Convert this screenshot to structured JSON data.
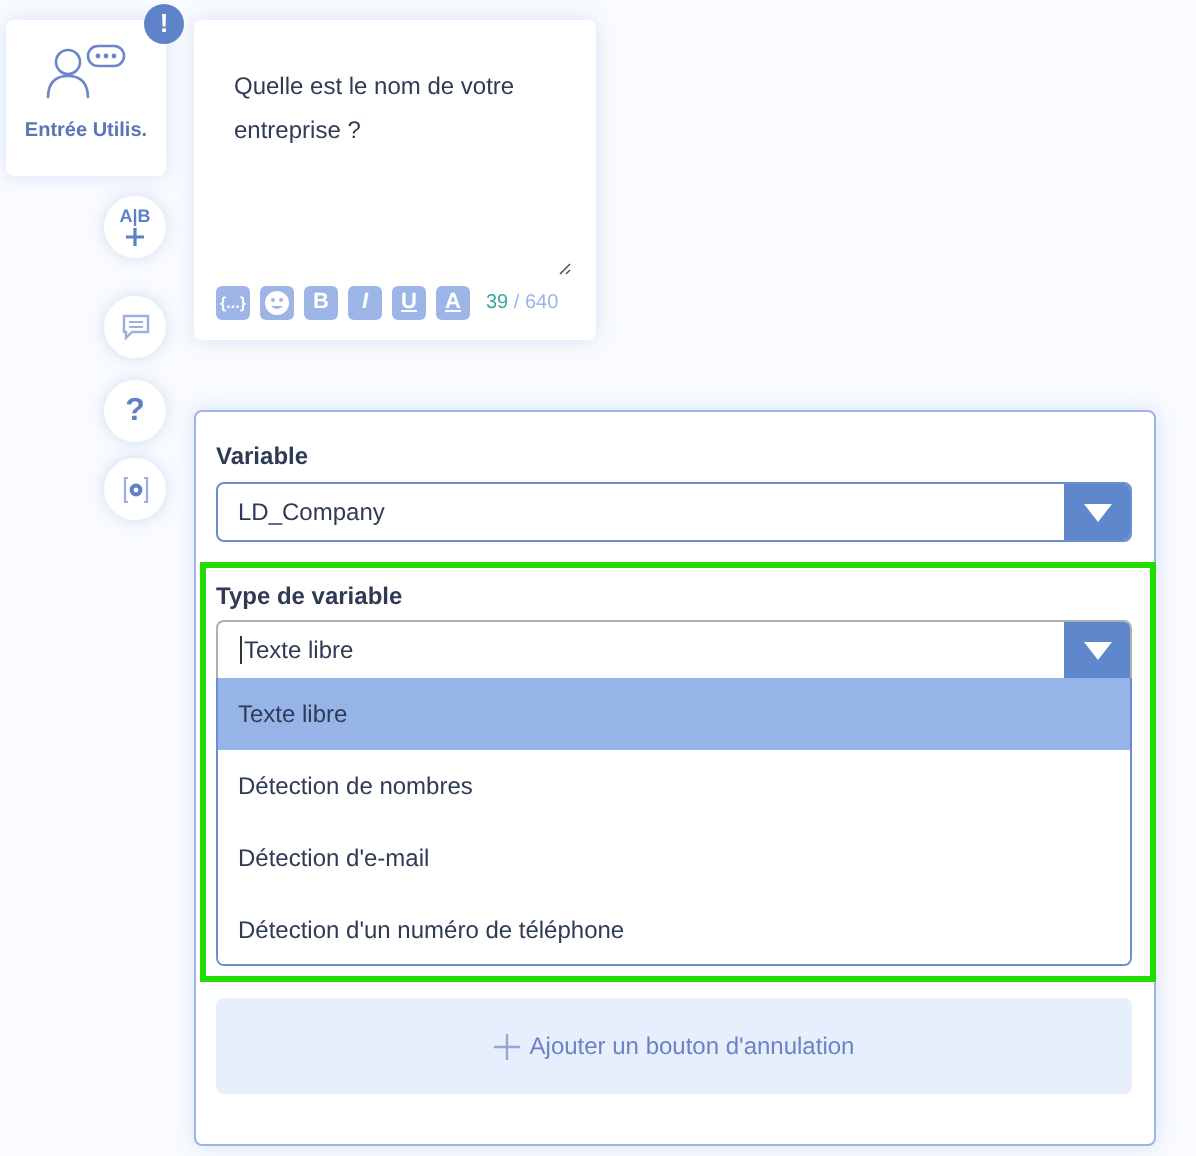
{
  "node": {
    "label": "Entrée Utilis.",
    "alert": "!"
  },
  "side_buttons": [
    {
      "kind": "ab",
      "label": "A|B"
    },
    {
      "kind": "comment"
    },
    {
      "kind": "help",
      "label": "?"
    },
    {
      "kind": "settings"
    }
  ],
  "message": {
    "text": "Quelle est le nom de votre entreprise ?",
    "toolbar": [
      {
        "kind": "text",
        "label": "{...}"
      },
      {
        "kind": "emoji"
      },
      {
        "kind": "text",
        "label": "B"
      },
      {
        "kind": "text",
        "label": "I"
      },
      {
        "kind": "text",
        "label": "U"
      },
      {
        "kind": "text",
        "label": "A"
      }
    ],
    "counter": {
      "used": "39",
      "separator": "/",
      "max": "640"
    }
  },
  "variable": {
    "label": "Variable",
    "value": "LD_Company"
  },
  "variable_type": {
    "label": "Type de variable",
    "value": "Texte libre",
    "options": [
      {
        "label": "Texte libre",
        "selected": true
      },
      {
        "label": "Détection de nombres",
        "selected": false
      },
      {
        "label": "Détection d'e-mail",
        "selected": false
      },
      {
        "label": "Détection d'un numéro de téléphone",
        "selected": false
      }
    ]
  },
  "cancel_button": {
    "label": "Ajouter un bouton d'annulation"
  }
}
